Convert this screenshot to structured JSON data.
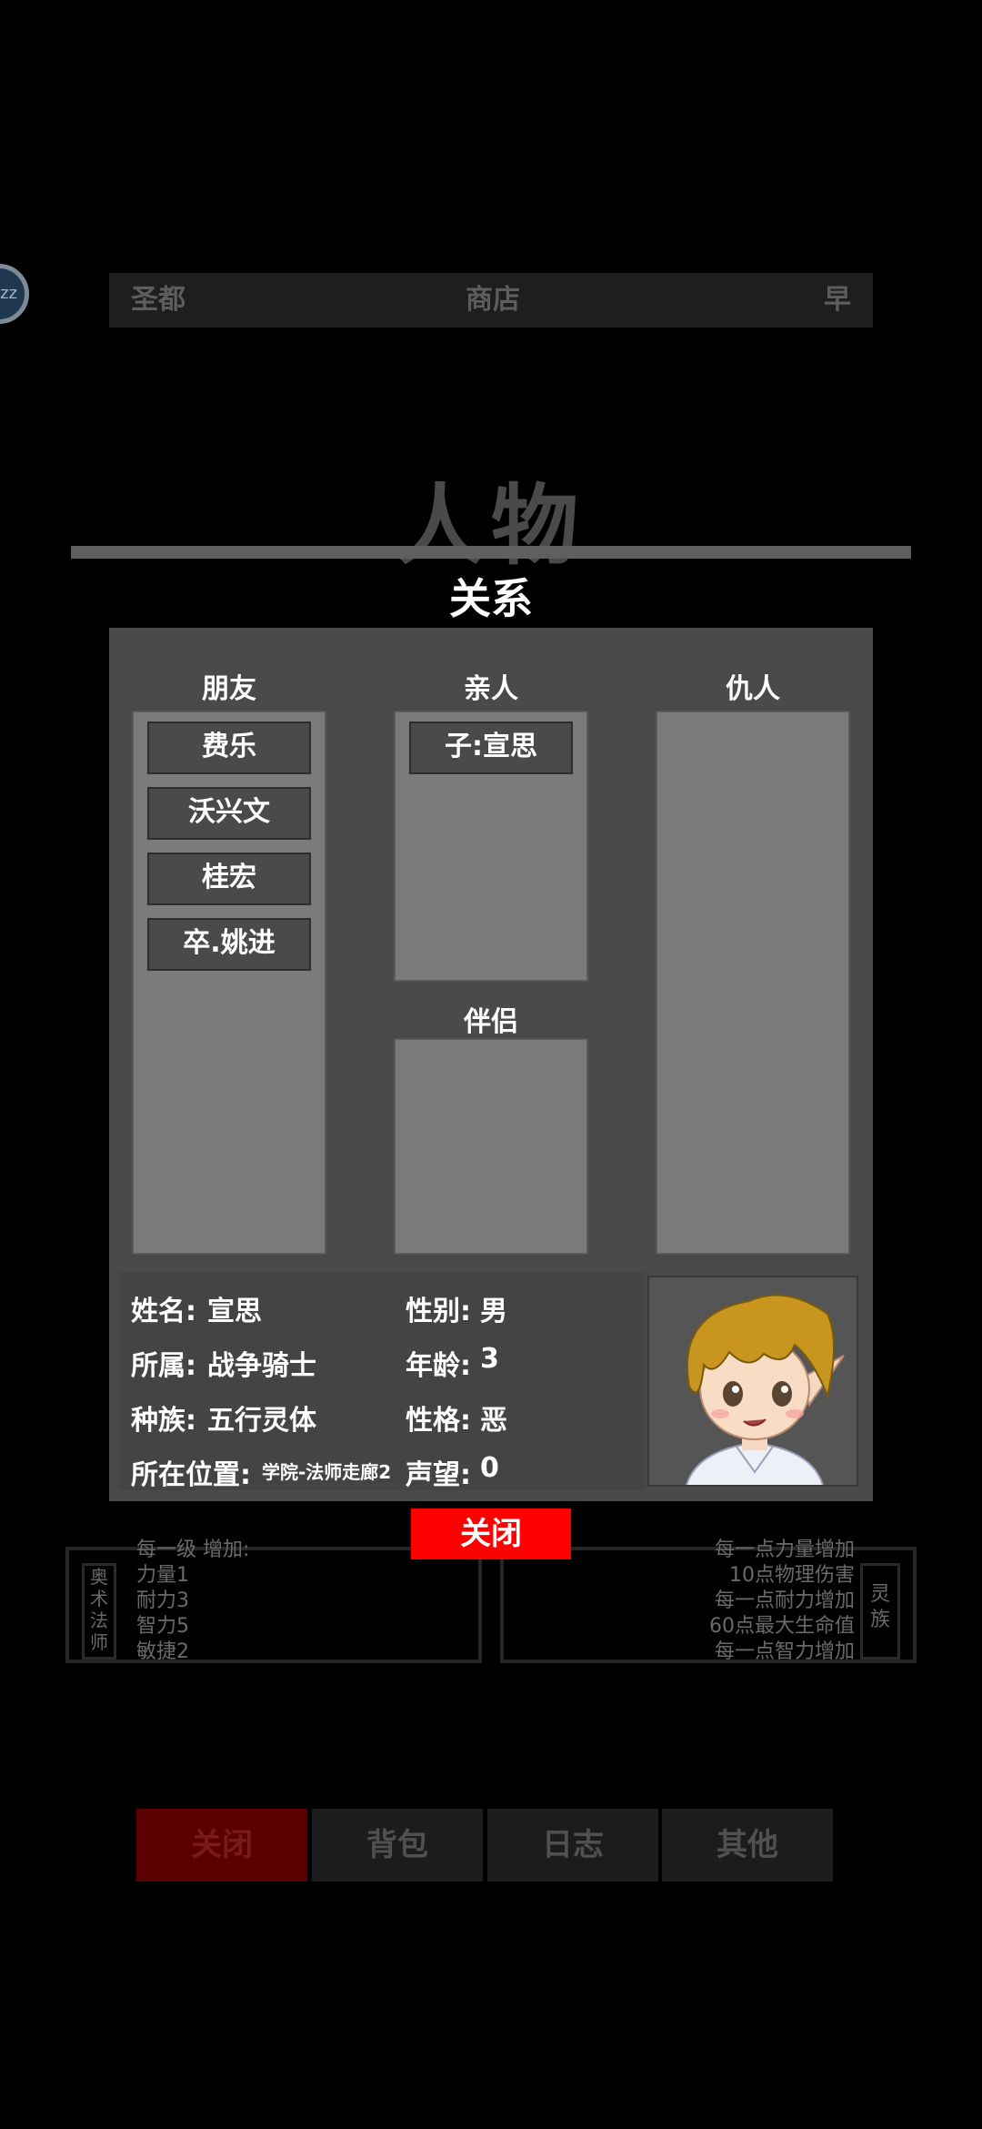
{
  "topbar": {
    "left": "圣都",
    "center": "商店",
    "right": "早"
  },
  "sleep_badge": "zz",
  "page_title": "人物",
  "dialog": {
    "title": "关系",
    "friends": {
      "heading": "朋友",
      "items": [
        "费乐",
        "沃兴文",
        "桂宏",
        "卒.姚进"
      ]
    },
    "family": {
      "heading": "亲人",
      "items": [
        "子:宣思"
      ]
    },
    "partner": {
      "heading": "伴侣",
      "items": []
    },
    "enemies": {
      "heading": "仇人",
      "items": []
    },
    "info": {
      "name_label": "姓名:",
      "name": "宣思",
      "gender_label": "性别:",
      "gender": "男",
      "faction_label": "所属:",
      "faction": "战争骑士",
      "age_label": "年龄:",
      "age": "3",
      "race_label": "种族:",
      "race": "五行灵体",
      "personality_label": "性格:",
      "personality": "恶",
      "location_label": "所在位置:",
      "location": "学院-法师走廊2",
      "reputation_label": "声望:",
      "reputation": "0"
    },
    "close_label": "关闭"
  },
  "background_panels": {
    "left_tag": [
      "奥",
      "术",
      "法",
      "师"
    ],
    "left_lines": [
      "每一级 增加:",
      "力量1",
      "耐力3",
      "智力5",
      "敏捷2"
    ],
    "right_tag": [
      "灵",
      "族"
    ],
    "right_lines": [
      "每一点力量增加",
      "10点物理伤害",
      "每一点耐力增加",
      "60点最大生命值",
      "每一点智力增加"
    ]
  },
  "bottom_nav": [
    "关闭",
    "背包",
    "日志",
    "其他"
  ],
  "colors": {
    "close_button": "#ff0000",
    "dialog_bg": "#4a4a4a",
    "list_bg": "#7b7b7b"
  }
}
